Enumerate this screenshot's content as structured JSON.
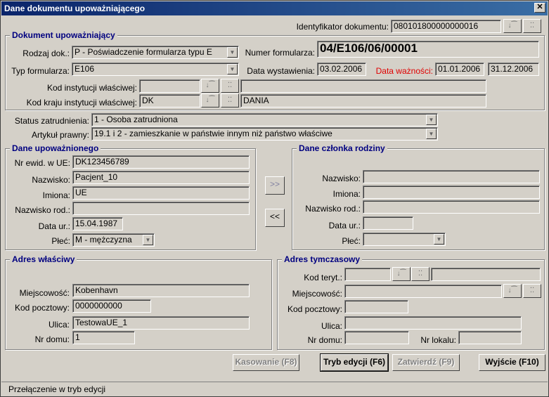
{
  "window": {
    "title": "Dane dokumentu upoważniającego",
    "close": "✕"
  },
  "header": {
    "doc_id_label": "Identyfikator dokumentu:",
    "doc_id_value": "080101800000000016"
  },
  "dokument": {
    "title": "Dokument upoważniający",
    "rodzaj_label": "Rodzaj dok.:",
    "rodzaj_value": "P - Poświadczenie formularza typu E",
    "numer_label": "Numer formularza:",
    "numer_value": "04/E106/06/00001",
    "typ_label": "Typ formularza:",
    "typ_value": "E106",
    "data_wyst_label": "Data wystawienia:",
    "data_wyst_value": "03.02.2006",
    "data_waz_label": "Data ważności:",
    "data_waz_from": "01.01.2006",
    "data_waz_to": "31.12.2006",
    "kod_inst_label": "Kod instytucji właściwej:",
    "kod_inst_value": "",
    "kod_inst_name": "",
    "kod_kraju_label": "Kod kraju instytucji właściwej:",
    "kod_kraju_value": "DK",
    "kod_kraju_name": "DANIA"
  },
  "status": {
    "status_label": "Status zatrudnienia:",
    "status_value": "1 - Osoba zatrudniona",
    "artykul_label": "Artykuł prawny:",
    "artykul_value": "19.1 i 2 - zamieszkanie w państwie innym niż państwo właściwe"
  },
  "upowaznionego": {
    "title": "Dane upoważnionego",
    "nr_label": "Nr ewid. w UE:",
    "nr_value": "DK123456789",
    "nazwisko_label": "Nazwisko:",
    "nazwisko_value": "Pacjent_10",
    "imiona_label": "Imiona:",
    "imiona_value": "UE",
    "nazwisko_rod_label": "Nazwisko rod.:",
    "nazwisko_rod_value": "",
    "data_ur_label": "Data ur.:",
    "data_ur_value": "15.04.1987",
    "plec_label": "Płeć:",
    "plec_value": "M - mężczyzna"
  },
  "transfer": {
    "right": ">>",
    "left": "<<"
  },
  "czlonka": {
    "title": "Dane członka rodziny",
    "nazwisko_label": "Nazwisko:",
    "imiona_label": "Imiona:",
    "nazwisko_rod_label": "Nazwisko rod.:",
    "data_ur_label": "Data ur.:",
    "plec_label": "Płeć:"
  },
  "adres_wlasciwy": {
    "title": "Adres właściwy",
    "miejscowosc_label": "Miejscowość:",
    "miejscowosc_value": "Kobenhavn",
    "kod_label": "Kod pocztowy:",
    "kod_value": "0000000000",
    "ulica_label": "Ulica:",
    "ulica_value": "TestowaUE_1",
    "nr_domu_label": "Nr domu:",
    "nr_domu_value": "1"
  },
  "adres_tymczasowy": {
    "title": "Adres tymczasowy",
    "kod_teryt_label": "Kod teryt.:",
    "miejscowosc_label": "Miejscowość:",
    "kod_label": "Kod pocztowy:",
    "ulica_label": "Ulica:",
    "nr_domu_label": "Nr domu:",
    "nr_lokalu_label": "Nr lokalu:"
  },
  "buttons": {
    "kasowanie": "Kasowanie (F8)",
    "tryb": "Tryb edycji (F6)",
    "zatwierdz": "Zatwierdź (F9)",
    "wyjscie": "Wyjście (F10)"
  },
  "statusbar": "Przełączenie w tryb edycji",
  "icons": {
    "lookup": "↓⁀",
    "dots": "⁚⁚",
    "combo_arrow": "▼"
  }
}
